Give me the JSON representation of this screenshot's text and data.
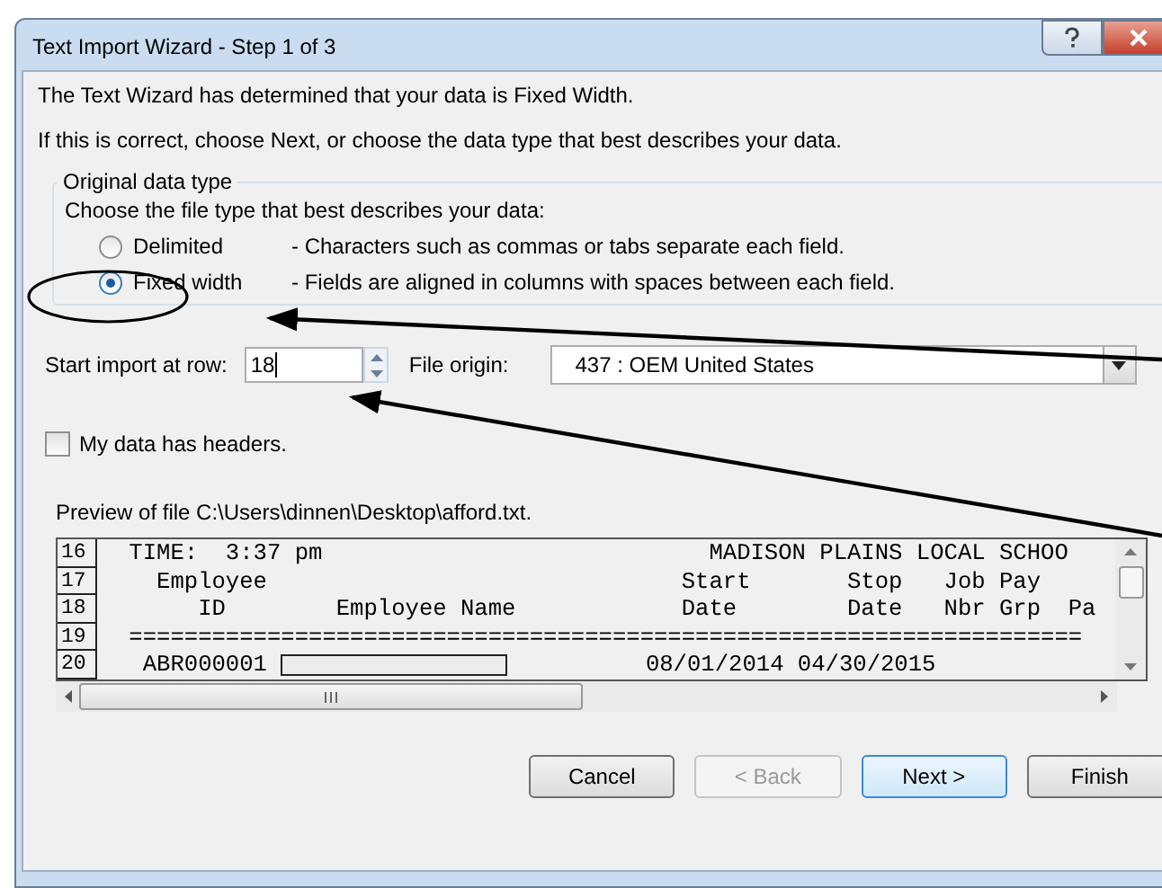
{
  "window": {
    "title": "Text Import Wizard - Step 1 of 3"
  },
  "intro": [
    "The Text Wizard has determined that your data is Fixed Width.",
    "If this is correct, choose Next, or choose the data type that best describes your data."
  ],
  "data_type": {
    "legend": "Original data type",
    "prompt": "Choose the file type that best describes your data:",
    "options": [
      {
        "label": "Delimited",
        "description": "- Characters such as commas or tabs separate each field.",
        "selected": false
      },
      {
        "label": "Fixed width",
        "description": "- Fields are aligned in columns with spaces between each field.",
        "selected": true
      }
    ]
  },
  "start_row": {
    "label": "Start import at row:",
    "value": "18"
  },
  "file_origin": {
    "label": "File origin:",
    "value": "437 : OEM United States"
  },
  "headers_checkbox": {
    "label": "My data has headers.",
    "checked": false
  },
  "preview": {
    "label": "Preview of file C:\\Users\\dinnen\\Desktop\\afford.txt.",
    "rows": [
      {
        "number": "16",
        "segments": [
          {
            "kind": "text",
            "text": " TIME:  3:37 pm                            MADISON PLAINS LOCAL SCHOO"
          }
        ]
      },
      {
        "number": "17",
        "segments": [
          {
            "kind": "text",
            "text": "   Employee                              Start       Stop   Job Pay"
          }
        ]
      },
      {
        "number": "18",
        "segments": [
          {
            "kind": "text",
            "text": "      ID        Employee Name            Date        Date   Nbr Grp  Pa"
          }
        ]
      },
      {
        "number": "19",
        "segments": [
          {
            "kind": "text",
            "text": " ====================================================================="
          }
        ]
      },
      {
        "number": "20",
        "segments": [
          {
            "kind": "text",
            "text": "  ABR000001 "
          },
          {
            "kind": "redacted"
          },
          {
            "kind": "text",
            "text": "          08/01/2014 04/30/2015"
          }
        ]
      }
    ]
  },
  "buttons": [
    {
      "label": "Cancel",
      "disabled": false,
      "focused": false
    },
    {
      "label": "< Back",
      "disabled": true,
      "focused": false
    },
    {
      "label": "Next >",
      "disabled": false,
      "focused": true
    },
    {
      "label": "Finish",
      "disabled": false,
      "focused": false
    }
  ]
}
